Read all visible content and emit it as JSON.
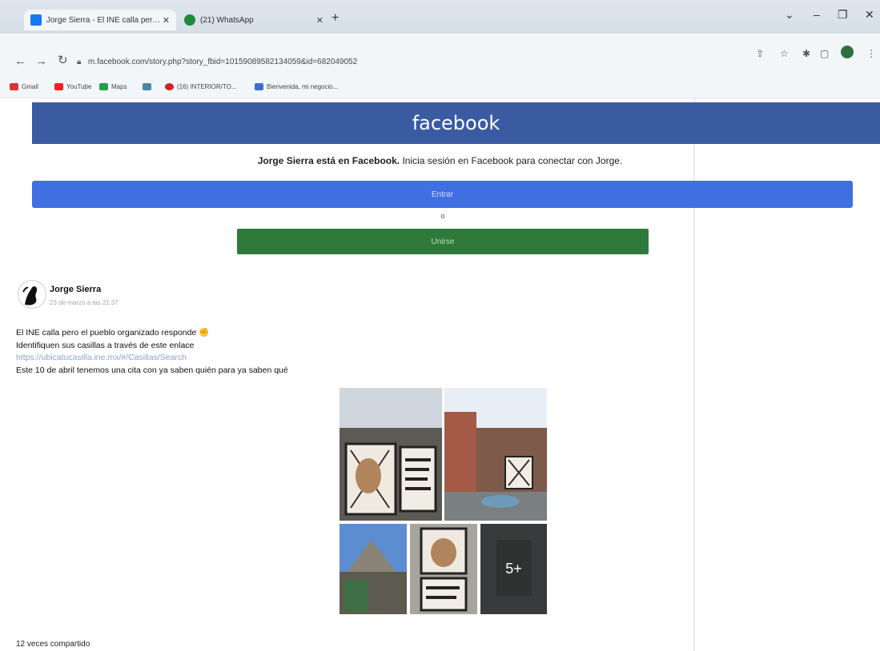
{
  "browser": {
    "tabs": [
      {
        "title": "Jorge Sierra - El INE calla pero ...",
        "active": true
      },
      {
        "title": "(21) WhatsApp",
        "active": false
      }
    ],
    "url": "m.facebook.com/story.php?story_fbid=10159089582134059&id=682049052",
    "bookmarks": [
      "Gmail",
      "YouTube",
      "Maps",
      "",
      "(16) INTERIOR/TO...",
      "Bienvenida, mi negocio..."
    ]
  },
  "colors": {
    "fb_blue": "#3a5aa2",
    "login_blue": "#3f6fe0",
    "register_green": "#2f7a3a"
  },
  "facebook": {
    "logo": "facebook",
    "join_bold": "Jorge Sierra está en Facebook.",
    "join_rest": " Inicia sesión en Facebook para conectar con Jorge.",
    "login_label": "Entrar",
    "or_label": "o",
    "register_label": "Unirse"
  },
  "post": {
    "author": "Jorge Sierra",
    "date": "23 de marzo a las 21:37",
    "lines": [
      "El INE calla pero el pueblo organizado responde ✊",
      "Identifiquen sus casillas a través de este enlace"
    ],
    "link": "https://ubicatucasilla.ine.mx/#/Casillas/Search ",
    "last_line": "Este 10 de abril tenemos una cita con ya saben quién para ya saben qué",
    "more_photos": "5+",
    "shares": "12 veces compartido"
  }
}
